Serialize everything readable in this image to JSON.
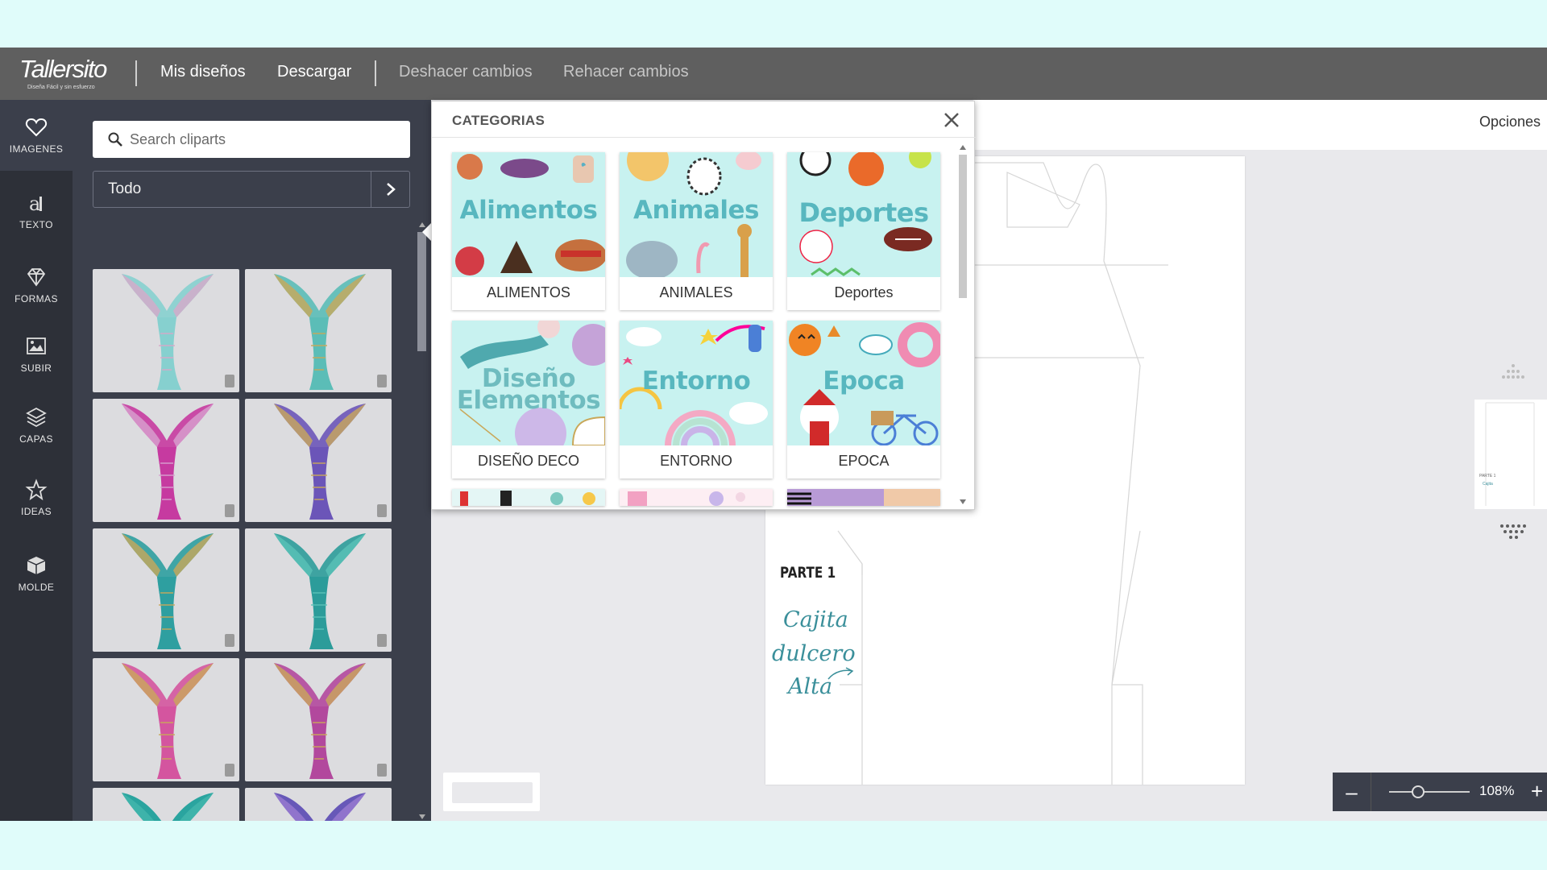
{
  "topbar": {
    "logo_text": "Tallersito",
    "logo_tagline": "Diseña Fácil y sin esfuerzo",
    "menu": [
      {
        "label": "Mis diseños"
      },
      {
        "label": "Descargar"
      },
      {
        "label": "Deshacer cambios"
      },
      {
        "label": "Rehacer cambios"
      }
    ]
  },
  "leftnav": {
    "items": [
      {
        "label": "IMAGENES",
        "icon": "heart-icon"
      },
      {
        "label": "TEXTO",
        "icon": "text-icon"
      },
      {
        "label": "FORMAS",
        "icon": "diamond-icon"
      },
      {
        "label": "SUBIR",
        "icon": "image-icon"
      },
      {
        "label": "CAPAS",
        "icon": "layers-icon"
      },
      {
        "label": "IDEAS",
        "icon": "star-icon"
      },
      {
        "label": "MOLDE",
        "icon": "cube-icon"
      }
    ]
  },
  "panel": {
    "search_placeholder": "Search cliparts",
    "filter_value": "Todo"
  },
  "cliparts": {
    "tails": [
      {
        "colors": [
          "#86d0cf",
          "#d7a9c9"
        ]
      },
      {
        "colors": [
          "#5bbdb7",
          "#c9a85a"
        ]
      },
      {
        "colors": [
          "#c63aa0",
          "#d8a1d0"
        ]
      },
      {
        "colors": [
          "#6b55b8",
          "#c9a85a"
        ]
      },
      {
        "colors": [
          "#2e9fa0",
          "#c9a85a"
        ]
      },
      {
        "colors": [
          "#2c9c9a",
          "#5ac2b8"
        ]
      },
      {
        "colors": [
          "#d4559f",
          "#c9a85a"
        ]
      },
      {
        "colors": [
          "#b2489d",
          "#c9a85a"
        ]
      },
      {
        "colors": [
          "#169d98",
          "#43b7ad"
        ]
      },
      {
        "colors": [
          "#5a49b4",
          "#9b7cd1"
        ]
      }
    ]
  },
  "canvas": {
    "options_label": "Opciones",
    "part_label": "PARTE 1",
    "lines": [
      "Cajita",
      "dulcero",
      "Alta"
    ],
    "zoom_value": "108%"
  },
  "categories": {
    "title": "CATEGORIAS",
    "items": [
      {
        "label": "ALIMENTOS",
        "art": "Alimentos"
      },
      {
        "label": "ANIMALES",
        "art": "Animales"
      },
      {
        "label": "Deportes",
        "art": "Deportes"
      },
      {
        "label": "DISEÑO DECO",
        "art_line1": "Diseño",
        "art_line2": "Elementos"
      },
      {
        "label": "ENTORNO",
        "art": "Entorno"
      },
      {
        "label": "EPOCA",
        "art": "Epoca"
      }
    ]
  }
}
